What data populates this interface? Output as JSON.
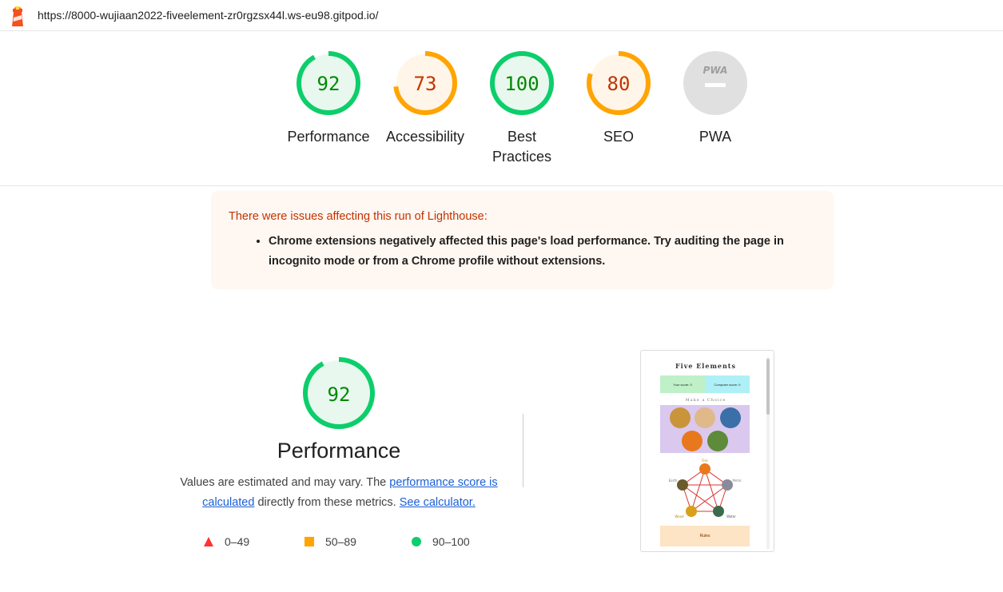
{
  "header": {
    "url": "https://8000-wujiaan2022-fiveelement-zr0rgzsx44l.ws-eu98.gitpod.io/"
  },
  "gauges": [
    {
      "label": "Performance",
      "score": "92",
      "value": 0.92,
      "color": "#0cce6b",
      "fill": "#e8f8ee",
      "text_color": "#008800"
    },
    {
      "label": "Accessibility",
      "score": "73",
      "value": 0.73,
      "color": "#ffa400",
      "fill": "#fff5e8",
      "text_color": "#c33300"
    },
    {
      "label_line1": "Best",
      "label_line2": "Practices",
      "score": "100",
      "value": 1.0,
      "color": "#0cce6b",
      "fill": "#e8f8ee",
      "text_color": "#008800"
    },
    {
      "label": "SEO",
      "score": "80",
      "value": 0.8,
      "color": "#ffa400",
      "fill": "#fff5e8",
      "text_color": "#c33300"
    },
    {
      "label": "PWA",
      "badge": "PWA",
      "color": "#e0e0e0",
      "icon": "pwa-icon"
    }
  ],
  "warning": {
    "title": "There were issues affecting this run of Lighthouse:",
    "items": [
      "Chrome extensions negatively affected this page's load performance. Try auditing the page in incognito mode or from a Chrome profile without extensions."
    ]
  },
  "performance": {
    "score": "92",
    "value": 0.92,
    "title": "Performance",
    "desc_prefix": "Values are estimated and may vary. The ",
    "link1": "performance score is calculated",
    "desc_middle": " directly from these metrics. ",
    "link2": "See calculator."
  },
  "legend": [
    {
      "range": "0–49",
      "shape": "triangle",
      "color": "#ff3333"
    },
    {
      "range": "50–89",
      "shape": "square",
      "color": "#ffa400"
    },
    {
      "range": "90–100",
      "shape": "circle",
      "color": "#0cce6b"
    }
  ],
  "screenshot": {
    "title": "Five Elements",
    "your_score": "Your score: 0",
    "computer_score": "Computer score: 0",
    "choice_label": "Make a Choice",
    "rules_label": "Rules",
    "elements": [
      "Fire",
      "Metal",
      "Water",
      "Wood",
      "Earth"
    ]
  }
}
